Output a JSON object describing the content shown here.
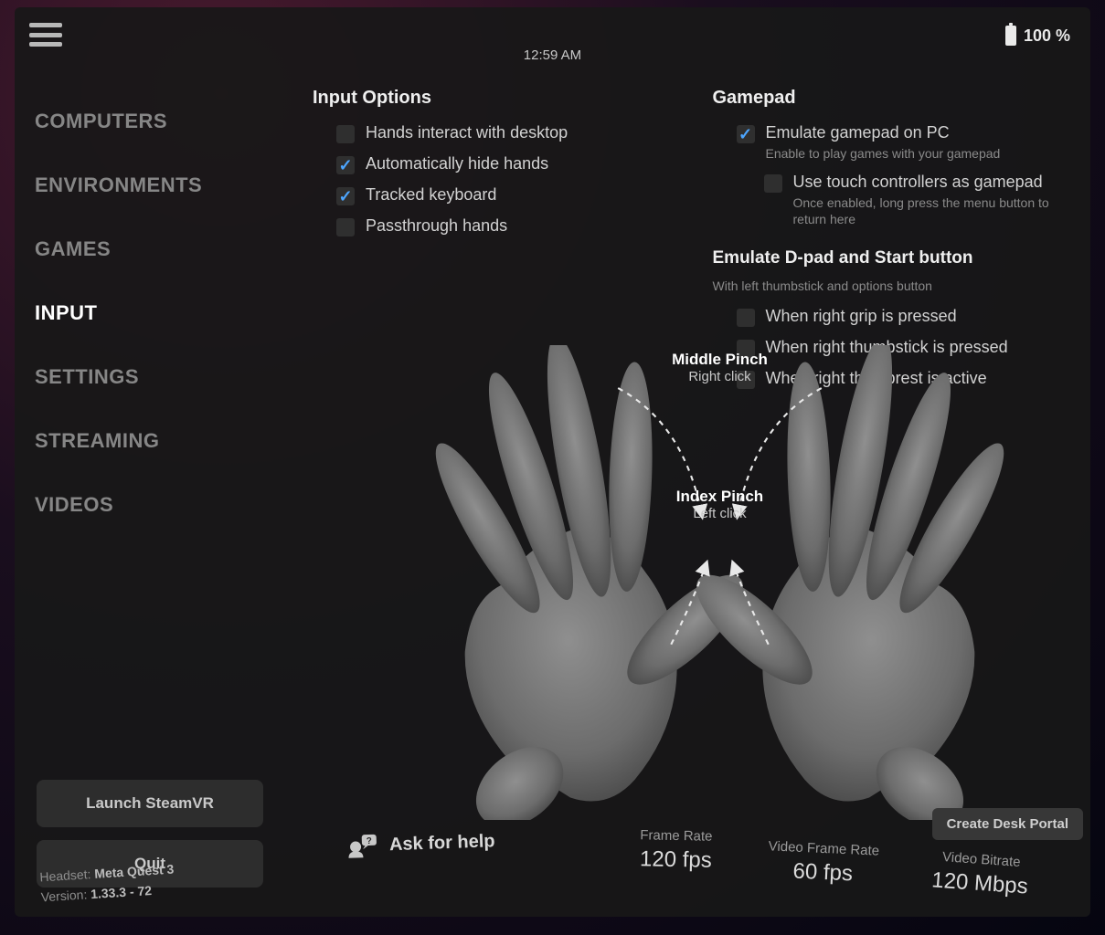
{
  "clock": "12:59 AM",
  "battery": "100 %",
  "sidebar": {
    "items": [
      {
        "label": "COMPUTERS"
      },
      {
        "label": "ENVIRONMENTS"
      },
      {
        "label": "GAMES"
      },
      {
        "label": "INPUT"
      },
      {
        "label": "SETTINGS"
      },
      {
        "label": "STREAMING"
      },
      {
        "label": "VIDEOS"
      }
    ],
    "active_index": 3,
    "buttons": {
      "launch": "Launch SteamVR",
      "quit": "Quit"
    }
  },
  "input_options": {
    "title": "Input Options",
    "items": [
      {
        "label": "Hands interact with desktop",
        "checked": false
      },
      {
        "label": "Automatically hide hands",
        "checked": true
      },
      {
        "label": "Tracked keyboard",
        "checked": true
      },
      {
        "label": "Passthrough hands",
        "checked": false
      }
    ]
  },
  "gamepad": {
    "title": "Gamepad",
    "items": [
      {
        "label": "Emulate gamepad on PC",
        "sub": "Enable to play games with your gamepad",
        "checked": true
      },
      {
        "label": "Use touch controllers as gamepad",
        "sub": "Once enabled, long press the menu button to return here",
        "checked": false
      }
    ]
  },
  "dpad": {
    "title": "Emulate D-pad and Start button",
    "desc": "With left thumbstick and options button",
    "items": [
      {
        "label": "When right grip is pressed",
        "checked": false
      },
      {
        "label": "When right thumbstick is pressed",
        "checked": false
      },
      {
        "label": "When right thumbrest is active",
        "checked": false
      }
    ]
  },
  "gestures": {
    "middle": {
      "title": "Middle Pinch",
      "sub": "Right click"
    },
    "index": {
      "title": "Index Pinch",
      "sub": "Left click"
    }
  },
  "create_desk_portal": "Create Desk Portal",
  "footer": {
    "headset_label": "Headset:",
    "headset_value": "Meta Quest 3",
    "version_label": "Version:",
    "version_value": "1.33.3 - 72",
    "ask_help": "Ask for help",
    "stats": [
      {
        "label": "Frame Rate",
        "value": "120 fps"
      },
      {
        "label": "Video Frame Rate",
        "value": "60 fps"
      },
      {
        "label": "Video Bitrate",
        "value": "120 Mbps"
      }
    ]
  }
}
